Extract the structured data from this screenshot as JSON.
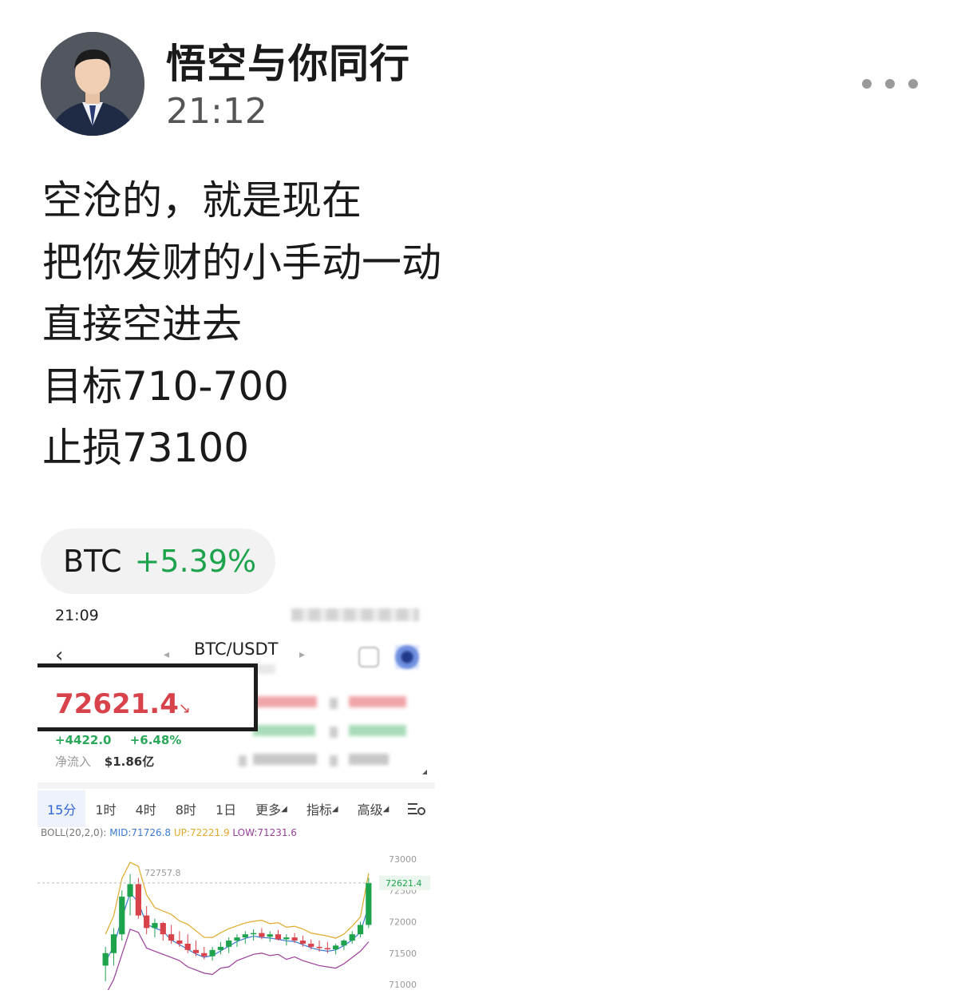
{
  "post": {
    "author": "悟空与你同行",
    "time": "21:12",
    "lines": [
      "空沧的，就是现在",
      "把你发财的小手动一动",
      "直接空进去",
      "目标710-700",
      "止损73100"
    ],
    "ticker": {
      "symbol": "BTC",
      "change": "+5.39%"
    }
  },
  "screenshot": {
    "status_time": "21:09",
    "pair": "BTC/USDT",
    "price": "72621.4",
    "price_arrow": "↘",
    "change_abs": "+4422.0",
    "change_pct": "+6.48%",
    "net_inflow_label": "净流入",
    "net_inflow_value": "$1.86亿",
    "tabs": [
      "15分",
      "1时",
      "4时",
      "8时",
      "1日",
      "更多",
      "指标",
      "高级"
    ],
    "active_tab": "15分",
    "boll": {
      "label": "BOLL(20,2,0):",
      "mid": "MID:71726.8",
      "up": "UP:72221.9",
      "low": "LOW:71231.6"
    },
    "chart_data": {
      "type": "candlestick",
      "y_ticks": [
        "73000",
        "72500",
        "72000",
        "71500",
        "71000"
      ],
      "ylim": [
        71000,
        73000
      ],
      "current_price_label": "72621.4",
      "high_annotation": "72757.8",
      "colors": {
        "up": "#1ea34d",
        "down": "#d8424a",
        "up_band": "#e0a92a",
        "mid_band": "#3a7bd5",
        "low_band": "#9a3f9a"
      },
      "candles": [
        {
          "o": 71300,
          "h": 71600,
          "l": 71050,
          "c": 71500
        },
        {
          "o": 71500,
          "h": 71900,
          "l": 71300,
          "c": 71800
        },
        {
          "o": 71800,
          "h": 72500,
          "l": 71700,
          "c": 72400
        },
        {
          "o": 72400,
          "h": 72760,
          "l": 72100,
          "c": 72600
        },
        {
          "o": 72600,
          "h": 72700,
          "l": 72050,
          "c": 72100
        },
        {
          "o": 72100,
          "h": 72250,
          "l": 71800,
          "c": 71900
        },
        {
          "o": 71900,
          "h": 72050,
          "l": 71750,
          "c": 71980
        },
        {
          "o": 71980,
          "h": 72000,
          "l": 71700,
          "c": 71800
        },
        {
          "o": 71800,
          "h": 71950,
          "l": 71650,
          "c": 71700
        },
        {
          "o": 71700,
          "h": 71850,
          "l": 71600,
          "c": 71650
        },
        {
          "o": 71650,
          "h": 71800,
          "l": 71500,
          "c": 71550
        },
        {
          "o": 71550,
          "h": 71700,
          "l": 71450,
          "c": 71500
        },
        {
          "o": 71500,
          "h": 71600,
          "l": 71400,
          "c": 71450
        },
        {
          "o": 71450,
          "h": 71600,
          "l": 71380,
          "c": 71550
        },
        {
          "o": 71550,
          "h": 71680,
          "l": 71480,
          "c": 71600
        },
        {
          "o": 71600,
          "h": 71750,
          "l": 71500,
          "c": 71700
        },
        {
          "o": 71700,
          "h": 71800,
          "l": 71600,
          "c": 71750
        },
        {
          "o": 71750,
          "h": 71850,
          "l": 71650,
          "c": 71800
        },
        {
          "o": 71800,
          "h": 71880,
          "l": 71700,
          "c": 71820
        },
        {
          "o": 71820,
          "h": 71900,
          "l": 71720,
          "c": 71760
        },
        {
          "o": 71760,
          "h": 71850,
          "l": 71680,
          "c": 71800
        },
        {
          "o": 71800,
          "h": 71870,
          "l": 71700,
          "c": 71720
        },
        {
          "o": 71720,
          "h": 71800,
          "l": 71620,
          "c": 71750
        },
        {
          "o": 71750,
          "h": 71820,
          "l": 71660,
          "c": 71700
        },
        {
          "o": 71700,
          "h": 71780,
          "l": 71600,
          "c": 71650
        },
        {
          "o": 71650,
          "h": 71720,
          "l": 71560,
          "c": 71600
        },
        {
          "o": 71600,
          "h": 71700,
          "l": 71520,
          "c": 71580
        },
        {
          "o": 71580,
          "h": 71680,
          "l": 71500,
          "c": 71560
        },
        {
          "o": 71560,
          "h": 71650,
          "l": 71480,
          "c": 71620
        },
        {
          "o": 71620,
          "h": 71720,
          "l": 71550,
          "c": 71700
        },
        {
          "o": 71700,
          "h": 71850,
          "l": 71650,
          "c": 71800
        },
        {
          "o": 71800,
          "h": 72000,
          "l": 71750,
          "c": 71950
        },
        {
          "o": 71950,
          "h": 72700,
          "l": 71900,
          "c": 72620
        }
      ]
    }
  }
}
